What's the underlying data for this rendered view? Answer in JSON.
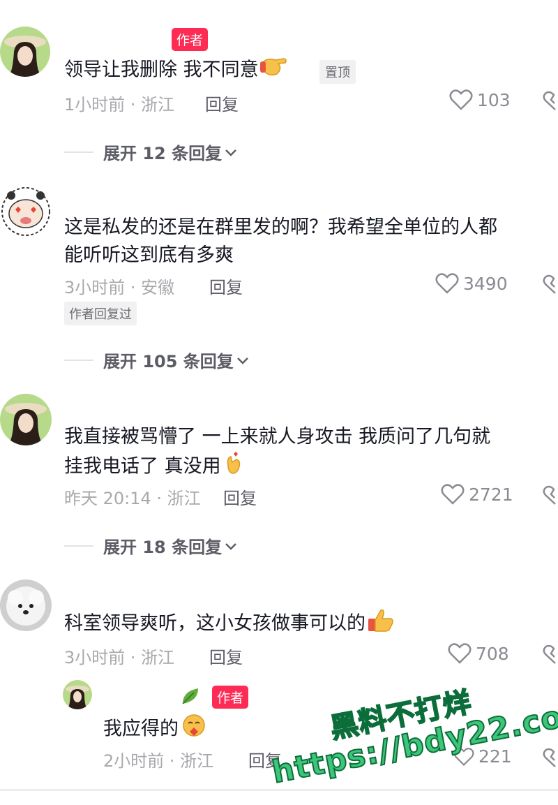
{
  "comments": [
    {
      "text": "领导让我删除 我不同意",
      "author_badge": "作者",
      "pin_badge": "置顶",
      "time_loc": "1小时前 · 浙江",
      "reply_label": "回复",
      "likes": "103",
      "expand_label": "展开 12 条回复",
      "emoji": "pointing-hand-icon"
    },
    {
      "text_line1": "这是私发的还是在群里发的啊？我希望全单位的人都",
      "text_line2": "能听听这到底有多爽",
      "time_loc": "3小时前 · 安徽",
      "reply_label": "回复",
      "likes": "3490",
      "author_replied": "作者回复过",
      "expand_label": "展开 105 条回复"
    },
    {
      "text_line1": "我直接被骂懵了 一上来就人身攻击 我质问了几句就",
      "text_line2": "挂我电话了 真没用",
      "time_loc": "昨天 20:14 · 浙江",
      "reply_label": "回复",
      "likes": "2721",
      "expand_label": "展开 18 条回复",
      "emoji": "finger-heart-icon"
    },
    {
      "text": "科室领导爽听，这小女孩做事可以的",
      "time_loc": "3小时前 · 浙江",
      "reply_label": "回复",
      "likes": "708",
      "emoji": "thumbs-up-icon"
    }
  ],
  "reply": {
    "author_badge": "作者",
    "text": "我应得的",
    "time_loc": "2小时前 · 浙江",
    "reply_label": "回复",
    "likes": "221",
    "emoji": "blushing-hug-icon"
  },
  "watermark": {
    "line1": "黑料不打烊",
    "line2": "https://bdy22.co"
  },
  "colors": {
    "accent": "#fe2c55",
    "meta_text": "#a8a8ad",
    "watermark_fill": "#3ec57a",
    "watermark_stroke": "#0b6e3a"
  }
}
